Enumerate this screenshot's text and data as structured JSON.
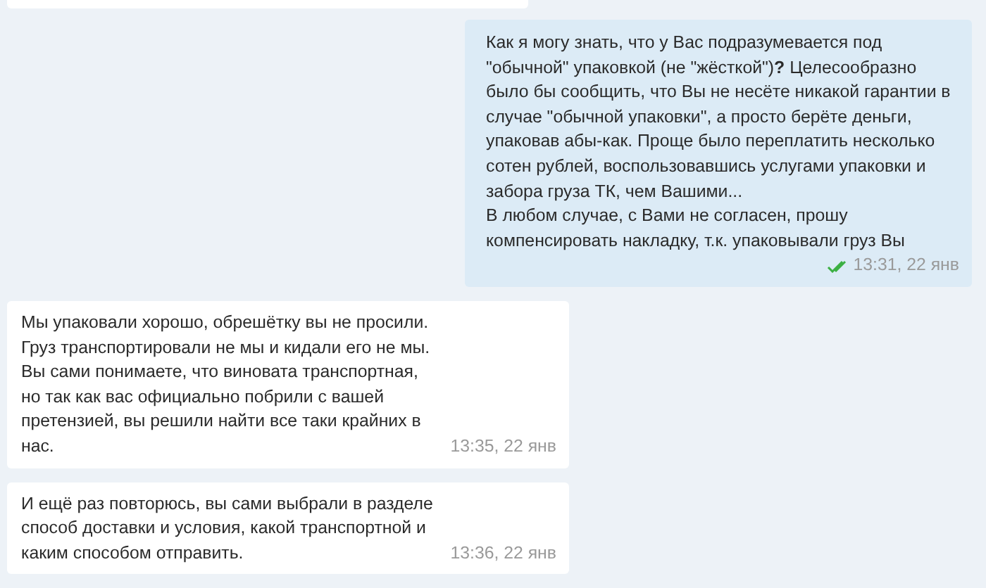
{
  "messages": [
    {
      "kind": "outgoing",
      "text": "Как я могу знать, что у Вас подразумевается под \"обычной\" упаковкой (не \"жёсткой\")**?** Целесообразно было бы сообщить, что Вы не несёте никакой гарантии в случае \"обычной упаковки\", а просто берёте деньги, упаковав абы-как. Проще было переплатить несколько сотен рублей, воспользовавшись услугами упаковки и забора груза ТК, чем Вашими...\nВ любом случае, с Вами не согласен, прошу компенсировать накладку, т.к. упаковывали груз Вы",
      "time": "13:31, 22 янв",
      "read": true
    },
    {
      "kind": "incoming",
      "text": "Мы упаковали хорошо, обрешётку вы не просили. Груз транспортировали не мы и кидали его не мы. Вы сами понимаете, что виновата транспортная, но так как вас официально побрили с вашей претензией, вы решили найти все таки крайних в нас.",
      "time": "13:35, 22 янв"
    },
    {
      "kind": "incoming",
      "text": "И ещё раз повторюсь, вы сами выбрали в разделе способ доставки и условия, какой транспортной и каким способом отправить.",
      "time": "13:36, 22 янв"
    }
  ]
}
